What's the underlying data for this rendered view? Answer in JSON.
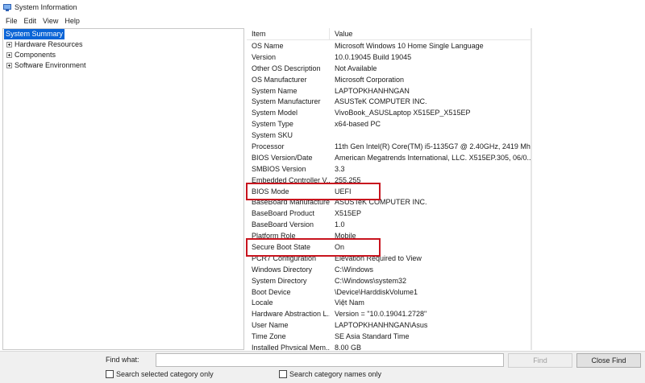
{
  "window": {
    "title": "System Information"
  },
  "menu": [
    "File",
    "Edit",
    "View",
    "Help"
  ],
  "tree": {
    "selected": "System Summary",
    "children": [
      "Hardware Resources",
      "Components",
      "Software Environment"
    ]
  },
  "list": {
    "headers": {
      "item": "Item",
      "value": "Value"
    },
    "rows": [
      {
        "item": "OS Name",
        "value": "Microsoft Windows 10 Home Single Language"
      },
      {
        "item": "Version",
        "value": "10.0.19045 Build 19045"
      },
      {
        "item": "Other OS Description",
        "value": "Not Available"
      },
      {
        "item": "OS Manufacturer",
        "value": "Microsoft Corporation"
      },
      {
        "item": "System Name",
        "value": "LAPTOPKHANHNGAN"
      },
      {
        "item": "System Manufacturer",
        "value": "ASUSTeK COMPUTER INC."
      },
      {
        "item": "System Model",
        "value": "VivoBook_ASUSLaptop X515EP_X515EP"
      },
      {
        "item": "System Type",
        "value": "x64-based PC"
      },
      {
        "item": "System SKU",
        "value": ""
      },
      {
        "item": "Processor",
        "value": "11th Gen Intel(R) Core(TM) i5-1135G7 @ 2.40GHz, 2419 Mh..."
      },
      {
        "item": "BIOS Version/Date",
        "value": "American Megatrends International, LLC. X515EP.305, 06/0..."
      },
      {
        "item": "SMBIOS Version",
        "value": "3.3"
      },
      {
        "item": "Embedded Controller V...",
        "value": "255.255"
      },
      {
        "item": "BIOS Mode",
        "value": "UEFI"
      },
      {
        "item": "BaseBoard Manufacturer",
        "value": "ASUSTeK COMPUTER INC."
      },
      {
        "item": "BaseBoard Product",
        "value": "X515EP"
      },
      {
        "item": "BaseBoard Version",
        "value": "1.0"
      },
      {
        "item": "Platform Role",
        "value": "Mobile"
      },
      {
        "item": "Secure Boot State",
        "value": "On"
      },
      {
        "item": "PCR7 Configuration",
        "value": "Elevation Required to View"
      },
      {
        "item": "Windows Directory",
        "value": "C:\\Windows"
      },
      {
        "item": "System Directory",
        "value": "C:\\Windows\\system32"
      },
      {
        "item": "Boot Device",
        "value": "\\Device\\HarddiskVolume1"
      },
      {
        "item": "Locale",
        "value": "Việt Nam"
      },
      {
        "item": "Hardware Abstraction L...",
        "value": "Version = \"10.0.19041.2728\""
      },
      {
        "item": "User Name",
        "value": "LAPTOPKHANHNGAN\\Asus"
      },
      {
        "item": "Time Zone",
        "value": "SE Asia Standard Time"
      },
      {
        "item": "Installed Physical Mem...",
        "value": "8.00 GB"
      }
    ]
  },
  "find": {
    "label": "Find what:",
    "value": "",
    "find_button": "Find",
    "close_button": "Close Find",
    "search_selected": "Search selected category only",
    "search_names": "Search category names only"
  },
  "colors": {
    "selection": "#0a64d6",
    "highlight_box": "#c8141e"
  }
}
